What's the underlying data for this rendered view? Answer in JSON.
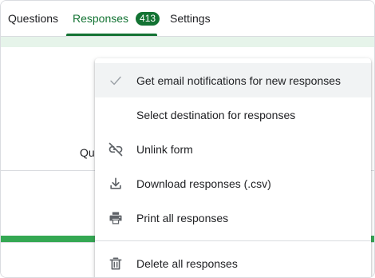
{
  "tabs": {
    "questions_label": "Questions",
    "responses_label": "Responses",
    "responses_count": "413",
    "settings_label": "Settings"
  },
  "background": {
    "partial_text": "Que"
  },
  "menu": {
    "items": [
      {
        "label": "Get email notifications for new responses",
        "icon": "check-icon"
      },
      {
        "label": "Select destination for responses",
        "icon": ""
      },
      {
        "label": "Unlink form",
        "icon": "unlink-icon"
      },
      {
        "label": "Download responses (.csv)",
        "icon": "download-icon"
      },
      {
        "label": "Print all responses",
        "icon": "print-icon"
      },
      {
        "label": "Delete all responses",
        "icon": "trash-icon"
      }
    ]
  },
  "colors": {
    "accent": "#137333",
    "progress_green": "#34a853",
    "band_green": "#e6f4ea"
  }
}
